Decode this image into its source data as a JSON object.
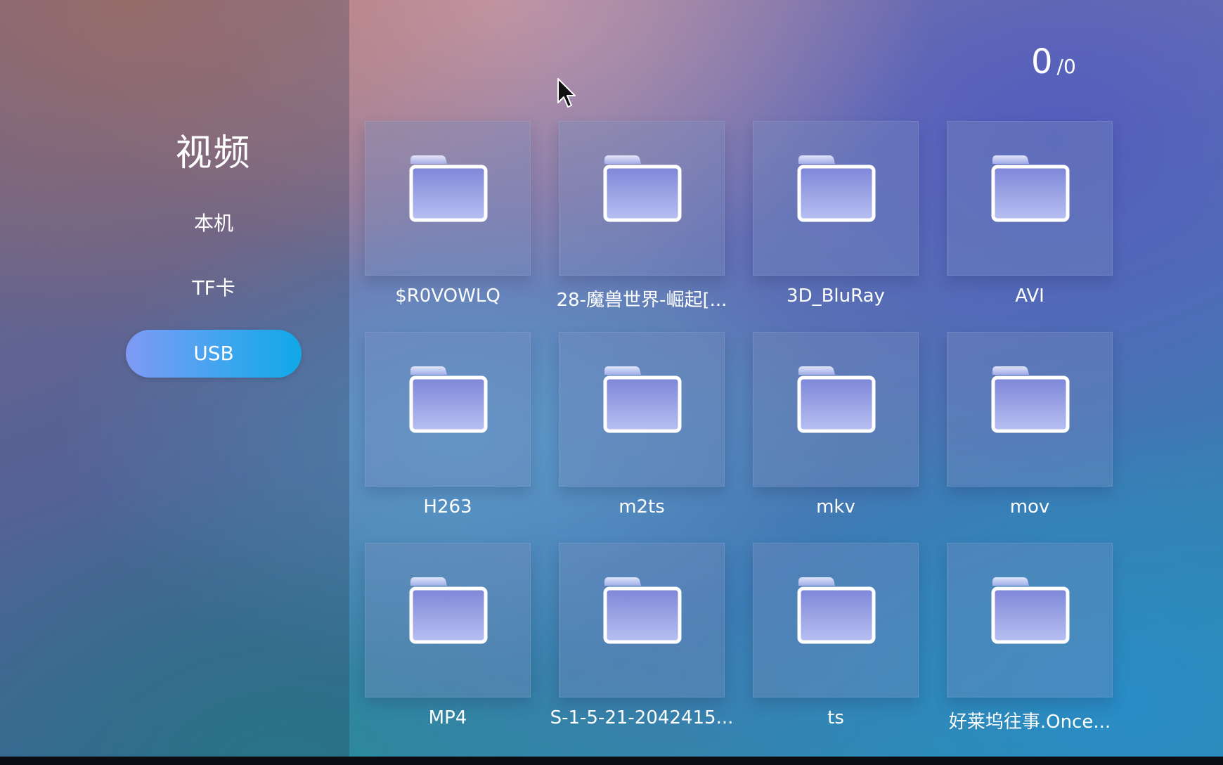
{
  "sidebar": {
    "title": "视频",
    "items": [
      {
        "label": "本机",
        "selected": false
      },
      {
        "label": "TF卡",
        "selected": false
      },
      {
        "label": "USB",
        "selected": true
      }
    ]
  },
  "counter": {
    "current": "0",
    "total": "/0"
  },
  "folders": [
    {
      "label": "$R0VOWLQ",
      "icon": "folder-icon"
    },
    {
      "label": "28-魔兽世界-崛起[...",
      "icon": "folder-icon"
    },
    {
      "label": "3D_BluRay",
      "icon": "folder-icon"
    },
    {
      "label": "AVI",
      "icon": "folder-icon"
    },
    {
      "label": "H263",
      "icon": "folder-icon"
    },
    {
      "label": "m2ts",
      "icon": "folder-icon"
    },
    {
      "label": "mkv",
      "icon": "folder-icon"
    },
    {
      "label": "mov",
      "icon": "folder-icon"
    },
    {
      "label": "MP4",
      "icon": "folder-icon"
    },
    {
      "label": "S-1-5-21-2042415...",
      "icon": "folder-icon"
    },
    {
      "label": "ts",
      "icon": "folder-icon"
    },
    {
      "label": "好莱坞往事.Once...",
      "icon": "folder-icon"
    }
  ],
  "colors": {
    "selected_start": "#7f9af5",
    "selected_end": "#10a8e8",
    "folder_outline": "#ffffff",
    "folder_fill_top": "#7d86d8",
    "folder_fill_bottom": "#b9c0f2"
  }
}
